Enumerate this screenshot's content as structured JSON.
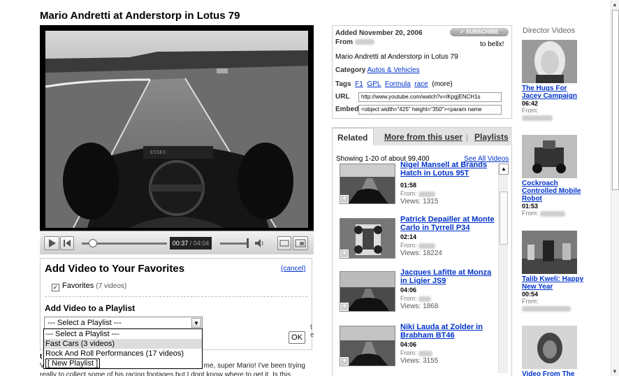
{
  "page": {
    "title": "Mario Andretti at Anderstorp in Lotus 79"
  },
  "player": {
    "time_current": "00:37",
    "time_separator": " / ",
    "time_total": "04:04"
  },
  "favorites": {
    "title": "Add Video to Your Favorites",
    "cancel": "(cancel)",
    "checkbox_label": "Favorites",
    "checkbox_count": "(7 videos)",
    "playlist_title": "Add Video to a Playlist",
    "select_value": "--- Select a Playlist ---",
    "ok": "OK",
    "options": [
      "--- Select a Playlist ---",
      "Fast Cars (3 videos)",
      "Rock And Roll Performances (17 videos)",
      "[ New Playlist ]"
    ],
    "selected_index": 1
  },
  "description": {
    "line1_start": "V",
    "line1_end": "me, super Mario! I've been trying",
    "line2": "really to collect some of his racing footages but I dont know where to get it. Is this",
    "left_fragment": "t",
    "side_fragment_1": "t",
    "side_fragment_2": "e"
  },
  "info": {
    "added_label": "Added",
    "added_value": "November 20, 2006",
    "from_label": "From",
    "subscribe": "✓ SUBSCRIBE",
    "subscribe_to": "to bellx!",
    "video_title": "Mario Andretti at Anderstorp in Lotus 79",
    "category_label": "Category",
    "category_value": "Autos & Vehicles",
    "tags_label": "Tags",
    "tags": [
      "F1",
      "GPL",
      "Formula",
      "race"
    ],
    "tags_more": "(more)",
    "url_label": "URL",
    "url_value": "http://www.youtube.com/watch?v=IKpgjENCH1s",
    "embed_label": "Embed",
    "embed_value": "<object width=\"425\" height=\"350\"><param name"
  },
  "tabs": {
    "related": "Related",
    "more": "More from this user",
    "playlists": "Playlists",
    "separator": "|"
  },
  "related": {
    "header": "Showing 1-20 of about 99,400",
    "see_all": "See All Videos",
    "from_label": "From:",
    "views_label": "Views:",
    "items": [
      {
        "title": "Nigel Mansell at Brands Hatch in Lotus 95T",
        "duration": "01:58",
        "views": "1315"
      },
      {
        "title": "Patrick Depailler at Monte Carlo in Tyrrell P34",
        "duration": "02:14",
        "views": "18224"
      },
      {
        "title": "Jacques Lafitte at Monza in Ligier JS9",
        "duration": "04:06",
        "views": "1868"
      },
      {
        "title": "Niki Lauda at Zolder in Brabham BT46",
        "duration": "04:06",
        "views": "3155"
      }
    ]
  },
  "director": {
    "title": "Director Videos",
    "from_label": "From:",
    "items": [
      {
        "title": "The Hugs For Jacey Campaign",
        "duration": "06:42"
      },
      {
        "title": "Cockroach Controlled Mobile Robot",
        "duration": "01:53"
      },
      {
        "title": "Talib Kweli: Happy New Year",
        "duration": "00:54"
      },
      {
        "title": "Video From The",
        "duration": ""
      }
    ]
  },
  "icons": {
    "play": "play-icon",
    "next": "next-icon",
    "volume": "volume-icon",
    "check": "✓",
    "dropdown": "▼",
    "up": "▲",
    "down": "▼",
    "plus": "+"
  }
}
